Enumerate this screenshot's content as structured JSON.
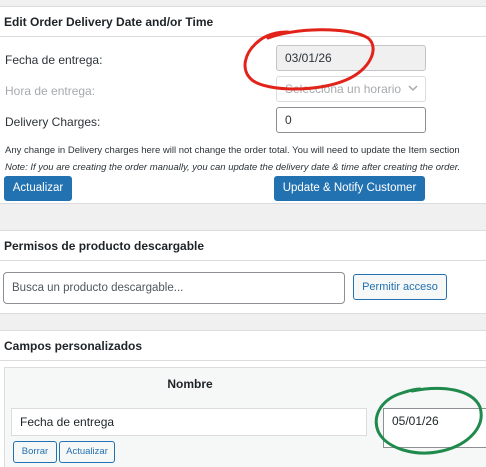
{
  "delivery": {
    "title": "Edit Order Delivery Date and/or Time",
    "date_label": "Fecha de entrega:",
    "date_value": "03/01/26",
    "time_label": "Hora de entrega:",
    "time_placeholder": "Selecciona un horario",
    "charges_label": "Delivery Charges:",
    "charges_value": "0",
    "note_charges": "Any change in Delivery charges here will not change the order total. You will need to update the Item section",
    "note_manual": "Note: If you are creating the order manually, you can update the delivery date & time after creating the order.",
    "update_button": "Actualizar",
    "notify_button": "Update & Notify Customer"
  },
  "downloads": {
    "title": "Permisos de producto descargable",
    "search_placeholder": "Busca un producto descargable...",
    "grant_button": "Permitir acceso"
  },
  "custom_fields": {
    "title": "Campos personalizados",
    "name_header": "Nombre",
    "row_name": "Fecha de entrega",
    "row_value": "05/01/26",
    "delete_button": "Borrar",
    "update_button": "Actualizar"
  },
  "annotations": {
    "red_circle_color": "#e2231a",
    "green_circle_color": "#1f8a4c"
  }
}
